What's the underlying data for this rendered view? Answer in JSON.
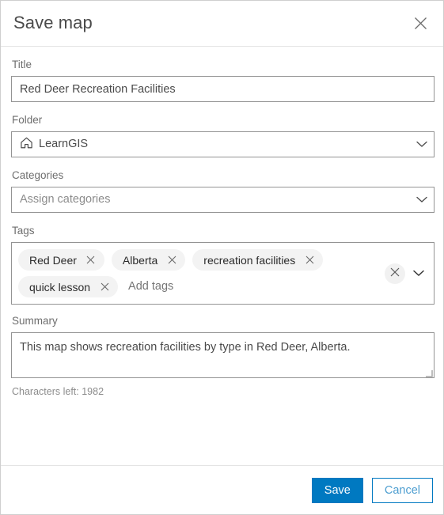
{
  "dialog": {
    "title": "Save map",
    "close_icon": "close-icon"
  },
  "form": {
    "title_field": {
      "label": "Title",
      "value": "Red Deer Recreation Facilities",
      "placeholder": "Title"
    },
    "folder_field": {
      "label": "Folder",
      "value": "LearnGIS",
      "icon": "home-icon",
      "chevron": "chevron-down-icon"
    },
    "categories_field": {
      "label": "Categories",
      "value": "",
      "placeholder": "Assign categories",
      "chevron": "chevron-down-icon"
    },
    "tags_field": {
      "label": "Tags",
      "placeholder": "Add tags",
      "chips": [
        {
          "label": "Red Deer"
        },
        {
          "label": "Alberta"
        },
        {
          "label": "recreation facilities"
        },
        {
          "label": "quick lesson"
        }
      ],
      "clear_icon": "close-icon",
      "chevron": "chevron-down-icon"
    },
    "summary_field": {
      "label": "Summary",
      "value": "This map shows recreation facilities by type in Red Deer, Alberta.",
      "placeholder": "Summary",
      "characters_left": "Characters left: 1982"
    }
  },
  "footer": {
    "save_label": "Save",
    "cancel_label": "Cancel"
  },
  "colors": {
    "accent": "#0079c1",
    "cancel_text": "#4d9ed0",
    "chip_bg": "#f3f3f3",
    "border": "#949494",
    "label": "#6e6e6e"
  }
}
